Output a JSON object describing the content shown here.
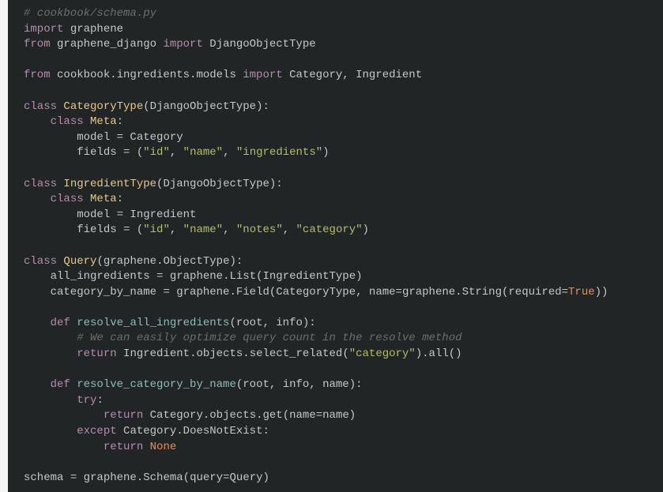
{
  "code": {
    "l1_comment": "# cookbook/schema.py",
    "l2_import": "import",
    "l2_graphene": " graphene",
    "l3_from": "from",
    "l3_mod": " graphene_django ",
    "l3_import": "import",
    "l3_type": " DjangoObjectType",
    "l5_from": "from",
    "l5_mod": " cookbook.ingredients.models ",
    "l5_import": "import",
    "l5_names": " Category, Ingredient",
    "l7_class": "class",
    "l7_name": " CategoryType",
    "l7_paren_open": "(",
    "l7_base": "DjangoObjectType",
    "l7_paren_close": "):",
    "l8_class": "class",
    "l8_name": " Meta",
    "l8_colon": ":",
    "l9_field": "        model ",
    "l9_eq": "=",
    "l9_val": " Category",
    "l10_field": "        fields ",
    "l10_eq": "=",
    "l10_op": " (",
    "l10_s1": "\"id\"",
    "l10_c1": ", ",
    "l10_s2": "\"name\"",
    "l10_c2": ", ",
    "l10_s3": "\"ingredients\"",
    "l10_cp": ")",
    "l12_class": "class",
    "l12_name": " IngredientType",
    "l12_paren_open": "(",
    "l12_base": "DjangoObjectType",
    "l12_paren_close": "):",
    "l13_class": "class",
    "l13_name": " Meta",
    "l13_colon": ":",
    "l14_field": "        model ",
    "l14_eq": "=",
    "l14_val": " Ingredient",
    "l15_field": "        fields ",
    "l15_eq": "=",
    "l15_op": " (",
    "l15_s1": "\"id\"",
    "l15_c1": ", ",
    "l15_s2": "\"name\"",
    "l15_c2": ", ",
    "l15_s3": "\"notes\"",
    "l15_c3": ", ",
    "l15_s4": "\"category\"",
    "l15_cp": ")",
    "l17_class": "class",
    "l17_name": " Query",
    "l17_po": "(",
    "l17_base1": "graphene",
    "l17_dot": ".",
    "l17_base2": "ObjectType",
    "l17_pc": "):",
    "l18_field": "    all_ingredients ",
    "l18_eq": "=",
    "l18_sp": " graphene",
    "l18_dot": ".",
    "l18_list": "List",
    "l18_po": "(",
    "l18_arg": "IngredientType",
    "l18_pc": ")",
    "l19_field": "    category_by_name ",
    "l19_eq": "=",
    "l19_sp": " graphene",
    "l19_dot": ".",
    "l19_field2": "Field",
    "l19_po": "(",
    "l19_arg1": "CategoryType",
    "l19_c1": ", name",
    "l19_eq2": "=",
    "l19_gr": "graphene",
    "l19_dot2": ".",
    "l19_str": "String",
    "l19_po2": "(",
    "l19_req": "required",
    "l19_eq3": "=",
    "l19_true": "True",
    "l19_pc": "))",
    "l21_def": "def",
    "l21_name": " resolve_all_ingredients",
    "l21_po": "(",
    "l21_args": "root, info",
    "l21_pc": "):",
    "l22_comment": "        # We can easily optimize query count in the resolve method",
    "l23_return": "return",
    "l23_ing": " Ingredient",
    "l23_dot": ".",
    "l23_obj": "objects",
    "l23_dot2": ".",
    "l23_sel": "select_related",
    "l23_po": "(",
    "l23_str": "\"category\"",
    "l23_pc": ")",
    "l23_dot3": ".",
    "l23_all": "all",
    "l23_pc2": "()",
    "l25_def": "def",
    "l25_name": " resolve_category_by_name",
    "l25_po": "(",
    "l25_args": "root, info, name",
    "l25_pc": "):",
    "l26_try": "try",
    "l26_colon": ":",
    "l27_return": "return",
    "l27_cat": " Category",
    "l27_dot": ".",
    "l27_obj": "objects",
    "l27_dot2": ".",
    "l27_get": "get",
    "l27_po": "(",
    "l27_name": "name",
    "l27_eq": "=",
    "l27_val": "name",
    "l27_pc": ")",
    "l28_except": "except",
    "l28_cat": " Category",
    "l28_dot": ".",
    "l28_dne": "DoesNotExist",
    "l28_colon": ":",
    "l29_return": "return",
    "l29_none": " None",
    "l31_schema": "schema ",
    "l31_eq": "=",
    "l31_gr": " graphene",
    "l31_dot": ".",
    "l31_sch": "Schema",
    "l31_po": "(",
    "l31_q": "query",
    "l31_eq2": "=",
    "l31_qv": "Query",
    "l31_pc": ")"
  }
}
